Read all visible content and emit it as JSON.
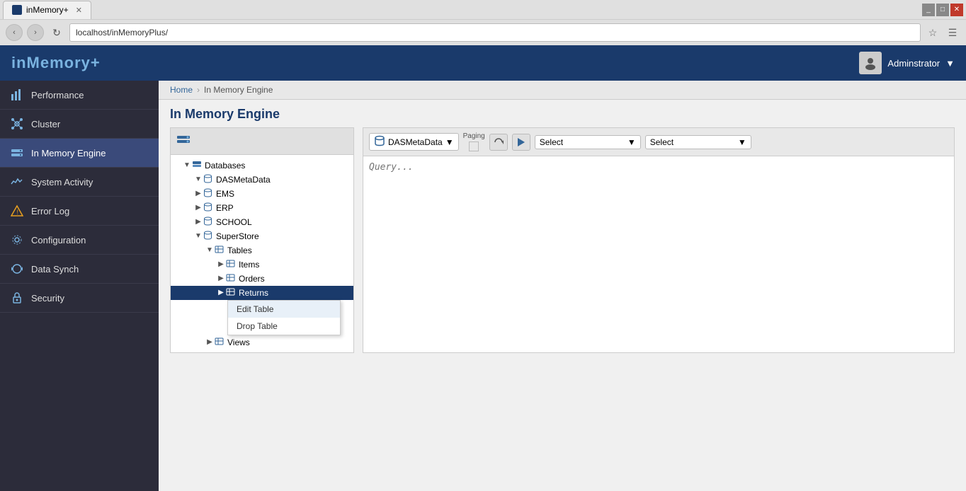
{
  "browser": {
    "tab_title": "inMemory+",
    "address": "localhost/inMemoryPlus/",
    "favicon": "🔷"
  },
  "app": {
    "logo": "inMemory+",
    "user": "Adminstrator"
  },
  "breadcrumb": {
    "home": "Home",
    "current": "In Memory Engine"
  },
  "page_title": "In Memory Engine",
  "sidebar": {
    "items": [
      {
        "id": "performance",
        "label": "Performance",
        "icon": "📊"
      },
      {
        "id": "cluster",
        "label": "Cluster",
        "icon": "🔗"
      },
      {
        "id": "inmemory",
        "label": "In Memory Engine",
        "icon": "💾",
        "active": true
      },
      {
        "id": "sysactivity",
        "label": "System Activity",
        "icon": "📈"
      },
      {
        "id": "errorlog",
        "label": "Error Log",
        "icon": "⚠"
      },
      {
        "id": "configuration",
        "label": "Configuration",
        "icon": "⚙"
      },
      {
        "id": "datasynch",
        "label": "Data Synch",
        "icon": "🔄"
      },
      {
        "id": "security",
        "label": "Security",
        "icon": "🔒"
      }
    ]
  },
  "tree": {
    "root_label": "Databases",
    "databases": [
      {
        "name": "DASMetaData",
        "expanded": true
      },
      {
        "name": "EMS"
      },
      {
        "name": "ERP"
      },
      {
        "name": "SCHOOL"
      },
      {
        "name": "SuperStore",
        "expanded": true,
        "children": [
          {
            "name": "Tables",
            "expanded": true,
            "children": [
              {
                "name": "Items"
              },
              {
                "name": "Orders"
              },
              {
                "name": "Returns",
                "selected": true,
                "context_menu": true
              }
            ]
          },
          {
            "name": "Views"
          }
        ]
      }
    ],
    "context_menu": {
      "items": [
        {
          "label": "Edit Table",
          "active": true
        },
        {
          "label": "Drop Table"
        }
      ]
    }
  },
  "query_toolbar": {
    "db_name": "DASMetaData",
    "paging_label": "Paging",
    "select1_label": "Select",
    "select2_label": "Select",
    "select1_placeholder": "Select",
    "select2_placeholder": "Select"
  },
  "query": {
    "placeholder": "Query..."
  }
}
